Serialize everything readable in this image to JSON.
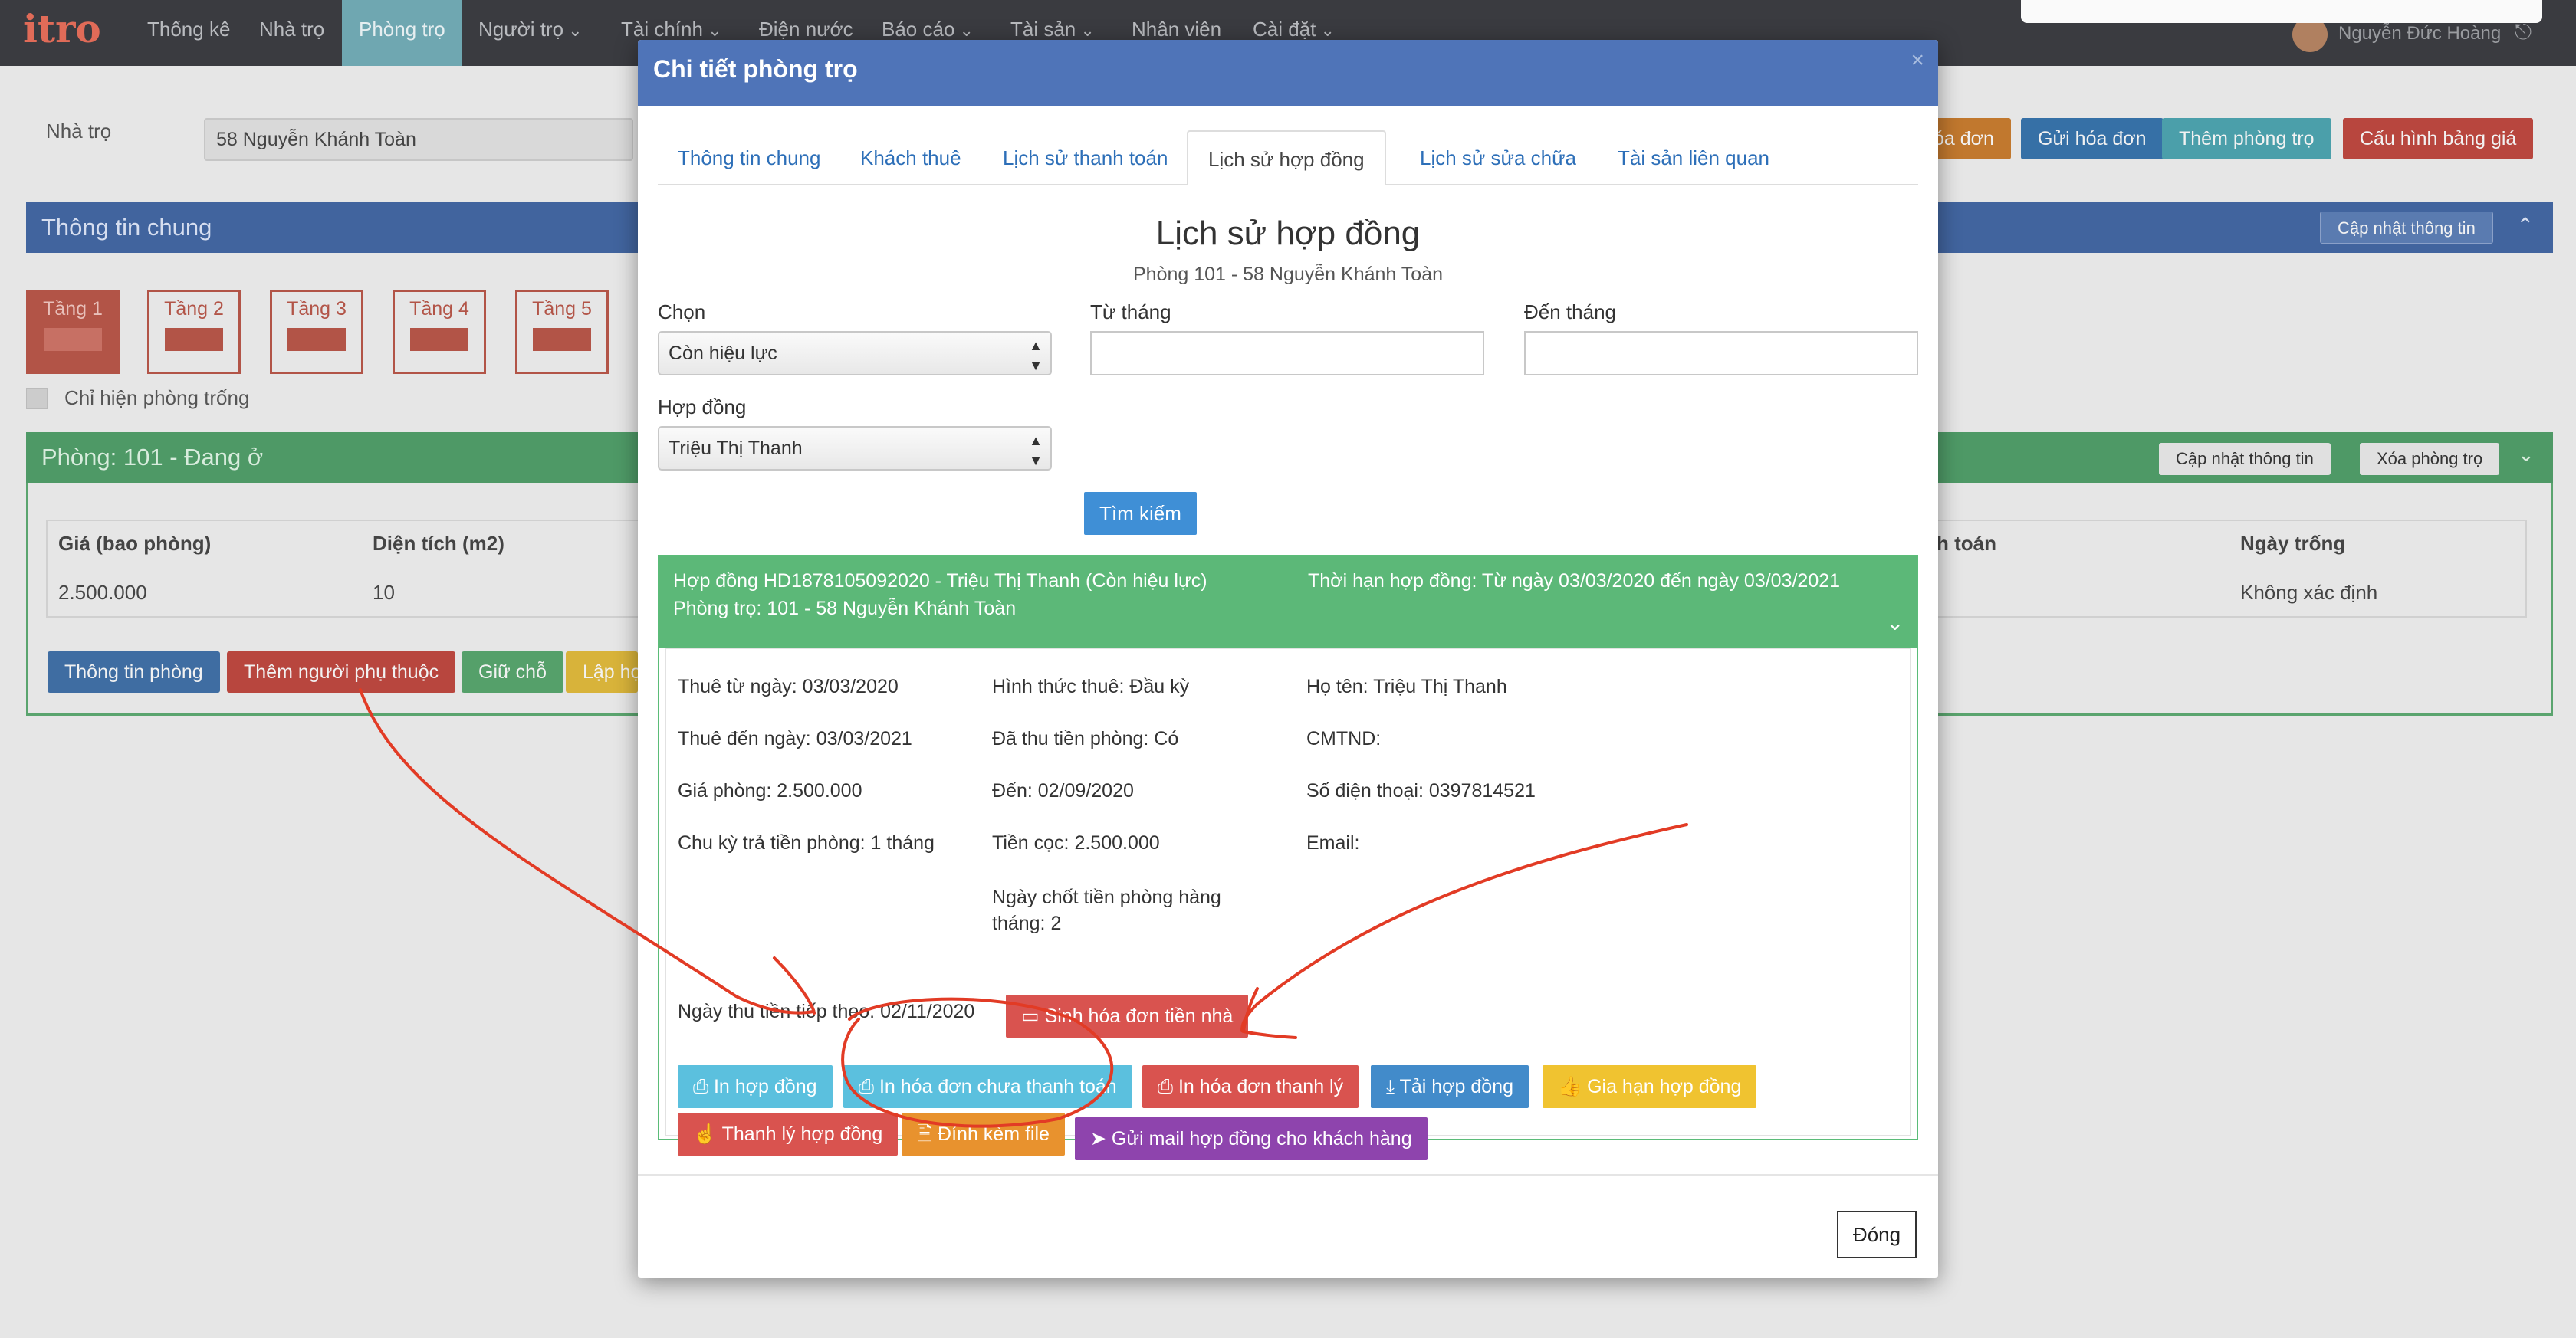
{
  "app": {
    "logo": "itro",
    "user": "Nguyễn Đức Hoàng"
  },
  "nav": [
    {
      "label": "Thống kê"
    },
    {
      "label": "Nhà trọ"
    },
    {
      "label": "Phòng trọ"
    },
    {
      "label": "Người trọ"
    },
    {
      "label": "Tài chính"
    },
    {
      "label": "Điện nước"
    },
    {
      "label": "Báo cáo"
    },
    {
      "label": "Tài sản"
    },
    {
      "label": "Nhân viên"
    },
    {
      "label": "Cài đặt"
    }
  ],
  "page": {
    "nha_tro_label": "Nhà trọ",
    "nha_tro_value": "58 Nguyễn Khánh Toàn",
    "top_buttons": [
      "óa đơn",
      "Gửi hóa đơn",
      "Thêm phòng trọ",
      "Cấu hình bảng giá"
    ],
    "general_title": "Thông tin chung",
    "update_info": "Cập nhật thông tin",
    "floors": [
      "Tầng 1",
      "Tầng 2",
      "Tầng 3",
      "Tầng 4",
      "Tầng 5"
    ],
    "only_empty": "Chỉ hiện phòng trống",
    "room_title": "Phòng: 101 - Đang ở",
    "room_update": "Cập nhật thông tin",
    "room_delete": "Xóa phòng trọ",
    "table_headers": [
      "Giá (bao phòng)",
      "Diện tích (m2)",
      "h toán",
      "Ngày trống"
    ],
    "table_values": [
      "2.500.000",
      "10",
      "Không xác định"
    ],
    "room_buttons": [
      "Thông tin phòng",
      "Thêm người phụ thuộc",
      "Giữ chỗ",
      "Lập hợ"
    ]
  },
  "modal": {
    "title": "Chi tiết phòng trọ",
    "close_x": "×",
    "tabs": [
      "Thông tin chung",
      "Khách thuê",
      "Lịch sử thanh toán",
      "Lịch sử hợp đồng",
      "Lịch sử sửa chữa",
      "Tài sản liên quan"
    ],
    "heading": "Lịch sử hợp đồng",
    "subheading": "Phòng 101 - 58 Nguyễn Khánh Toàn",
    "chon_label": "Chọn",
    "chon_value": "Còn hiệu lực",
    "tu_thang_label": "Từ tháng",
    "den_thang_label": "Đến tháng",
    "hop_dong_label": "Hợp đồng",
    "hop_dong_value": "Triệu Thị Thanh",
    "search_button": "Tìm kiếm",
    "contract_line1": "Hợp đồng HD1878105092020 - Triệu Thị Thanh (Còn hiệu lực)",
    "contract_line2": "Phòng trọ: 101 - 58 Nguyễn Khánh Toàn",
    "contract_term": "Thời hạn hợp đồng: Từ ngày 03/03/2020 đến ngày 03/03/2021",
    "col1": [
      "Thuê từ ngày: 03/03/2020",
      "Thuê đến ngày: 03/03/2021",
      "Giá phòng: 2.500.000",
      "Chu kỳ trả tiền phòng: 1 tháng"
    ],
    "col2": [
      "Hình thức thuê: Đầu kỳ",
      "Đã thu tiền phòng: Có",
      "Đến: 02/09/2020",
      "Tiền cọc: 2.500.000",
      "Ngày chốt tiền phòng hàng tháng: 2"
    ],
    "col3": [
      "Họ tên: Triệu Thị Thanh",
      "CMTND:",
      "Số điện thoại: 0397814521",
      "Email:"
    ],
    "next_payment": "Ngày thu tiền tiếp theo: 02/11/2020",
    "generate_invoice": "Sinh hóa đơn tiền nhà",
    "actions": [
      {
        "label": "In hợp đồng",
        "color": "#5bc0de"
      },
      {
        "label": "In hóa đơn chưa thanh toán",
        "color": "#5bc0de"
      },
      {
        "label": "In hóa đơn thanh lý",
        "color": "#d9534f"
      },
      {
        "label": "Tải hợp đồng",
        "color": "#428bca"
      },
      {
        "label": "Gia hạn hợp đồng",
        "color": "#f0c330"
      },
      {
        "label": "Thanh lý hợp đồng",
        "color": "#d9534f"
      },
      {
        "label": "Đính kèm file",
        "color": "#e8922e"
      },
      {
        "label": "Gửi mail hợp đồng cho khách hàng",
        "color": "#8e44ad"
      }
    ],
    "close_button": "Đóng"
  }
}
